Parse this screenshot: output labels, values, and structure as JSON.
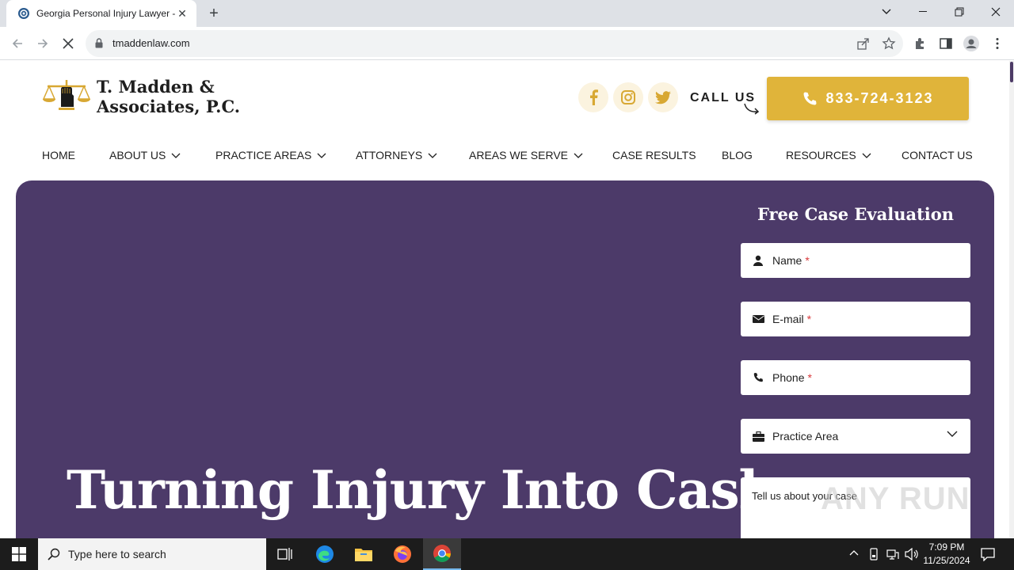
{
  "browser": {
    "tab_title": "Georgia Personal Injury Lawyer -",
    "url": "tmaddenlaw.com"
  },
  "site": {
    "logo_line1": "T. Madden &",
    "logo_line2": "Associates, P.C.",
    "call_us": "CALL US",
    "phone": "833-724-3123",
    "nav": [
      {
        "label": "HOME",
        "dropdown": false
      },
      {
        "label": "ABOUT US",
        "dropdown": true
      },
      {
        "label": "PRACTICE AREAS",
        "dropdown": true
      },
      {
        "label": "ATTORNEYS",
        "dropdown": true
      },
      {
        "label": "AREAS WE SERVE",
        "dropdown": true
      },
      {
        "label": "CASE RESULTS",
        "dropdown": false
      },
      {
        "label": "BLOG",
        "dropdown": false
      },
      {
        "label": "RESOURCES",
        "dropdown": true
      },
      {
        "label": "CONTACT US",
        "dropdown": false
      }
    ],
    "hero_title": "Turning Injury Into Cash",
    "form": {
      "title": "Free Case Evaluation",
      "name_label": "Name",
      "email_label": "E-mail",
      "phone_label": "Phone",
      "required_mark": "*",
      "practice_area": "Practice Area",
      "message_placeholder": "Tell us about your case"
    },
    "colors": {
      "brand_purple": "#4c3a69",
      "accent_gold": "#e0b43a"
    }
  },
  "watermark": "ANY RUN",
  "taskbar": {
    "search_placeholder": "Type here to search",
    "time": "7:09 PM",
    "date": "11/25/2024"
  }
}
